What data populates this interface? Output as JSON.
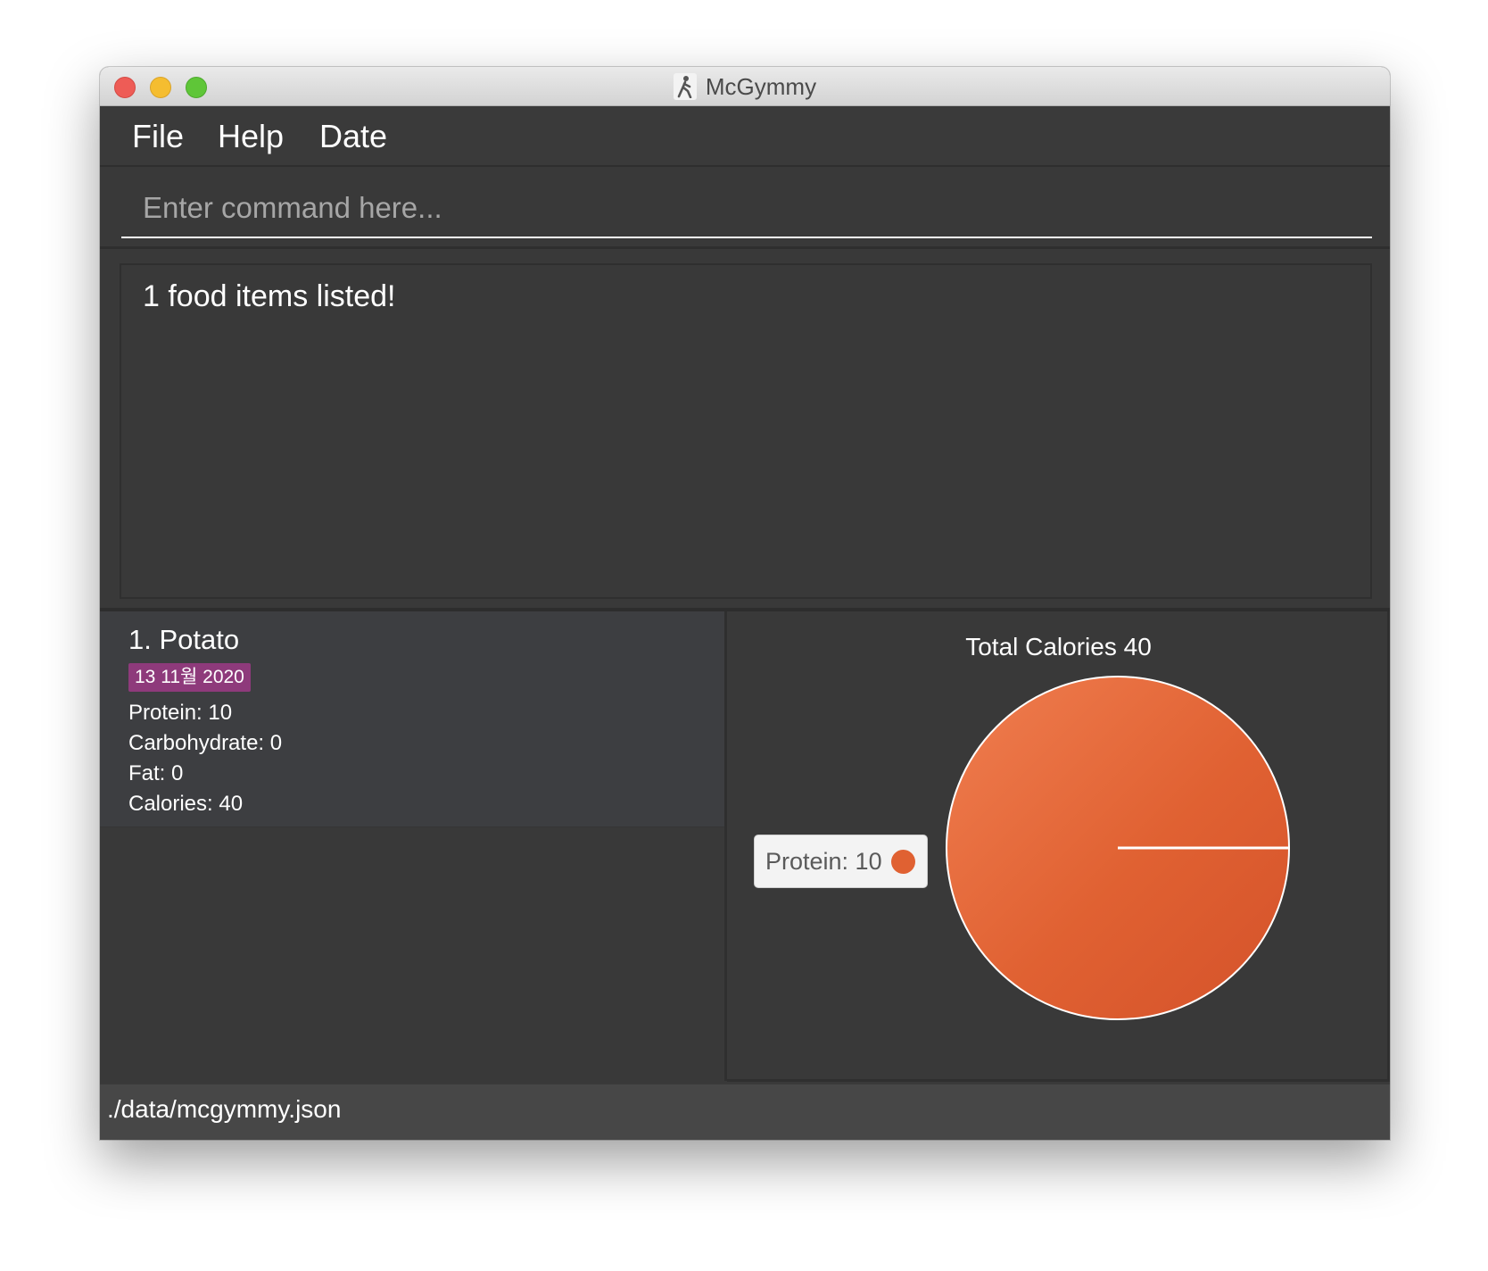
{
  "window": {
    "title": "McGymmy",
    "icon": "running-figure-icon"
  },
  "menu": {
    "items": [
      "File",
      "Help",
      "Date"
    ]
  },
  "command": {
    "placeholder": "Enter command here..."
  },
  "result": {
    "message": "1 food items listed!"
  },
  "food_list": {
    "items": [
      {
        "index_name": "1.  Potato",
        "date": "13 11월 2020",
        "protein": "Protein: 10",
        "carbohydrate": "Carbohydrate: 0",
        "fat": "Fat: 0",
        "calories": "Calories: 40"
      }
    ]
  },
  "chart": {
    "title": "Total Calories 40",
    "legend": [
      "Protein: 10"
    ]
  },
  "chart_data": {
    "type": "pie",
    "title": "Total Calories 40",
    "labels": [
      "Protein: 10"
    ],
    "values": [
      10
    ],
    "colors": [
      "#e06132"
    ]
  },
  "status": {
    "path": "./data/mcgymmy.json"
  },
  "colors": {
    "background": "#393939",
    "card": "#3d3e41",
    "date_tag": "#8e3a7b",
    "slice": "#e06132",
    "statusbar": "#474747"
  }
}
